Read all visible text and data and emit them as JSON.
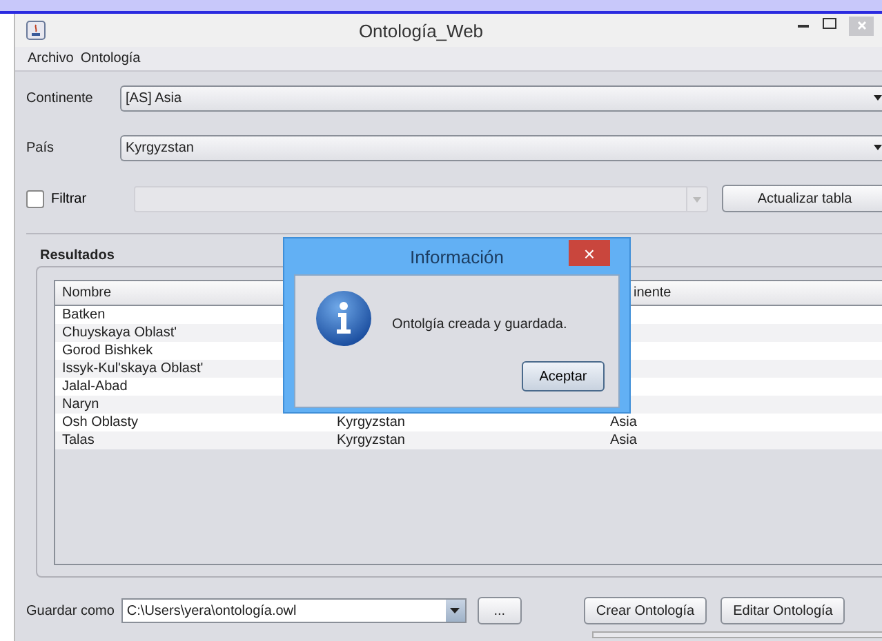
{
  "window": {
    "title": "Ontología_Web"
  },
  "menu": [
    "Archivo",
    "Ontología"
  ],
  "form": {
    "continent_label": "Continente",
    "continent_value": "[AS] Asia",
    "country_label": "País",
    "country_value": "Kyrgyzstan",
    "filter_label": "Filtrar",
    "filter_checked": false,
    "update_button": "Actualizar tabla"
  },
  "results": {
    "title": "Resultados",
    "columns": [
      "Nombre",
      "inente"
    ],
    "rows": [
      {
        "name": "Batken"
      },
      {
        "name": "Chuyskaya Oblast'"
      },
      {
        "name": "Gorod Bishkek"
      },
      {
        "name": "Issyk-Kul'skaya Oblast'"
      },
      {
        "name": "Jalal-Abad"
      },
      {
        "name": "Naryn"
      },
      {
        "name": "Osh Oblasty",
        "country": "Kyrgyzstan",
        "continent": "Asia"
      },
      {
        "name": "Talas",
        "country": "Kyrgyzstan",
        "continent": "Asia"
      }
    ]
  },
  "save": {
    "label": "Guardar como",
    "path": "C:\\Users\\yera\\ontología.owl",
    "browse_button": "...",
    "create_button": "Crear Ontología",
    "edit_button": "Editar Ontología"
  },
  "dialog": {
    "title": "Información",
    "close": "×",
    "message": "Ontolgía creada y guardada.",
    "button": "Aceptar"
  }
}
